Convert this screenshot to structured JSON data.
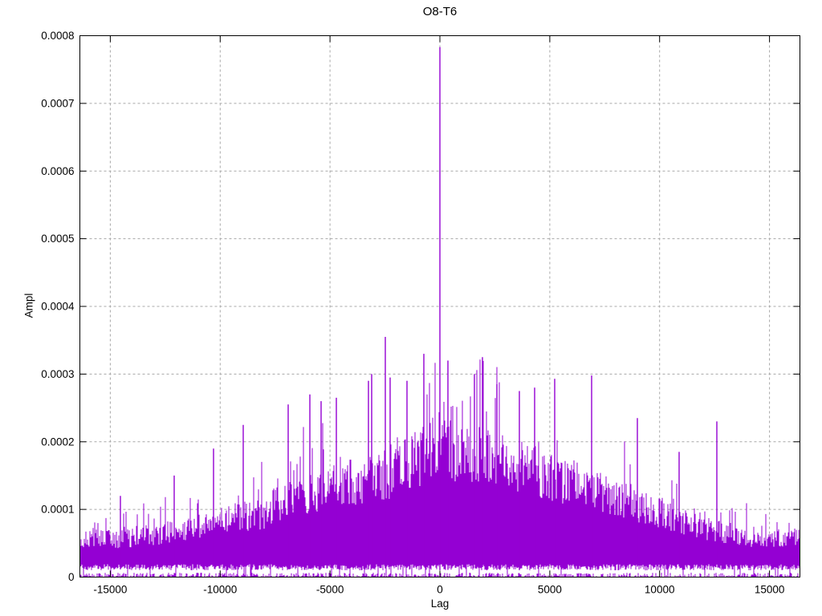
{
  "chart_data": {
    "type": "line",
    "plot_style": "dense impulse-like noise trace (|cross-correlation| amplitude vs lag), gnuplot-style",
    "title": "O8-T6",
    "xlabel": "Lag",
    "ylabel": "Ampl",
    "xlim": [
      -16384,
      16384
    ],
    "ylim": [
      0,
      0.0008
    ],
    "grid": true,
    "legend": "none",
    "line_color": "#9400D3",
    "grid_color": "#A8A8A8",
    "axis_color": "#000000",
    "background_color": "#FFFFFF",
    "x_ticks": [
      {
        "v": -15000,
        "label": "-15000"
      },
      {
        "v": -10000,
        "label": "-10000"
      },
      {
        "v": -5000,
        "label": "-5000"
      },
      {
        "v": 0,
        "label": "0"
      },
      {
        "v": 5000,
        "label": "5000"
      },
      {
        "v": 10000,
        "label": "10000"
      },
      {
        "v": 15000,
        "label": "15000"
      }
    ],
    "y_ticks": [
      {
        "v": 0,
        "label": "0"
      },
      {
        "v": 0.0001,
        "label": "0.0001"
      },
      {
        "v": 0.0002,
        "label": "0.0002"
      },
      {
        "v": 0.0003,
        "label": "0.0003"
      },
      {
        "v": 0.0004,
        "label": "0.0004"
      },
      {
        "v": 0.0005,
        "label": "0.0005"
      },
      {
        "v": 0.0006,
        "label": "0.0006"
      },
      {
        "v": 0.0007,
        "label": "0.0007"
      },
      {
        "v": 0.0008,
        "label": "0.0008"
      }
    ],
    "envelope": [
      [
        -16384,
        6.8e-05
      ],
      [
        -15000,
        7e-05
      ],
      [
        -14000,
        7.2e-05
      ],
      [
        -13000,
        7.8e-05
      ],
      [
        -12000,
        8.5e-05
      ],
      [
        -11000,
        9.5e-05
      ],
      [
        -10000,
        0.000105
      ],
      [
        -9000,
        0.000112
      ],
      [
        -8000,
        0.000118
      ],
      [
        -7000,
        0.000145
      ],
      [
        -6000,
        0.000155
      ],
      [
        -5000,
        0.000165
      ],
      [
        -4000,
        0.000175
      ],
      [
        -3000,
        0.000185
      ],
      [
        -2000,
        0.000195
      ],
      [
        -1000,
        0.00022
      ],
      [
        0,
        0.000245
      ],
      [
        1000,
        0.00023
      ],
      [
        2000,
        0.00022
      ],
      [
        3000,
        0.00021
      ],
      [
        4000,
        0.0002
      ],
      [
        5000,
        0.000185
      ],
      [
        6000,
        0.000175
      ],
      [
        7000,
        0.000165
      ],
      [
        8000,
        0.00015
      ],
      [
        9000,
        0.000135
      ],
      [
        10000,
        0.00012
      ],
      [
        11000,
        0.000105
      ],
      [
        12000,
        9e-05
      ],
      [
        13000,
        8.2e-05
      ],
      [
        14000,
        7.5e-05
      ],
      [
        15000,
        7e-05
      ],
      [
        16384,
        7.5e-05
      ]
    ],
    "peaks": [
      [
        0,
        0.000783
      ],
      [
        -2480,
        0.000355
      ],
      [
        -740,
        0.00033
      ],
      [
        365,
        0.00032
      ],
      [
        1930,
        0.000325
      ],
      [
        1570,
        0.0003
      ],
      [
        -3100,
        0.0003
      ],
      [
        -3250,
        0.00029
      ],
      [
        -2250,
        0.000295
      ],
      [
        5220,
        0.000293
      ],
      [
        6900,
        0.000298
      ],
      [
        -1500,
        0.00029
      ],
      [
        2600,
        0.000285
      ],
      [
        4300,
        0.00028
      ],
      [
        -5900,
        0.00027
      ],
      [
        -5400,
        0.00026
      ],
      [
        -4700,
        0.000265
      ],
      [
        3600,
        0.000275
      ],
      [
        8980,
        0.000235
      ],
      [
        12600,
        0.00023
      ],
      [
        -8950,
        0.000225
      ],
      [
        -14550,
        0.00012
      ],
      [
        -10300,
        0.00019
      ],
      [
        10900,
        0.000185
      ],
      [
        -6900,
        0.000255
      ],
      [
        -12100,
        0.00015
      ]
    ],
    "noise": {
      "mass_bottom_min": 1e-05,
      "mass_bottom_max": 1.9e-05,
      "spike_probability": 0.13,
      "seed": 1337
    }
  }
}
